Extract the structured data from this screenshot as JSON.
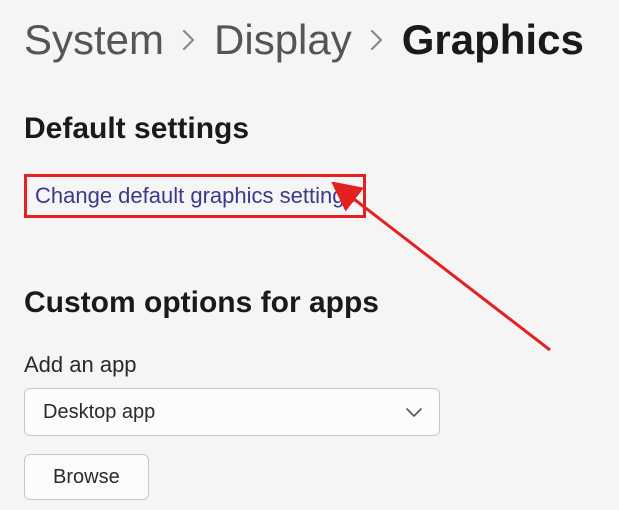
{
  "breadcrumb": {
    "items": [
      "System",
      "Display",
      "Graphics"
    ]
  },
  "defaultSection": {
    "title": "Default settings",
    "linkText": "Change default graphics settings"
  },
  "customSection": {
    "title": "Custom options for apps",
    "addLabel": "Add an app",
    "dropdown": {
      "selected": "Desktop app"
    },
    "browseLabel": "Browse"
  },
  "annotation": {
    "highlightColor": "#e42020"
  }
}
